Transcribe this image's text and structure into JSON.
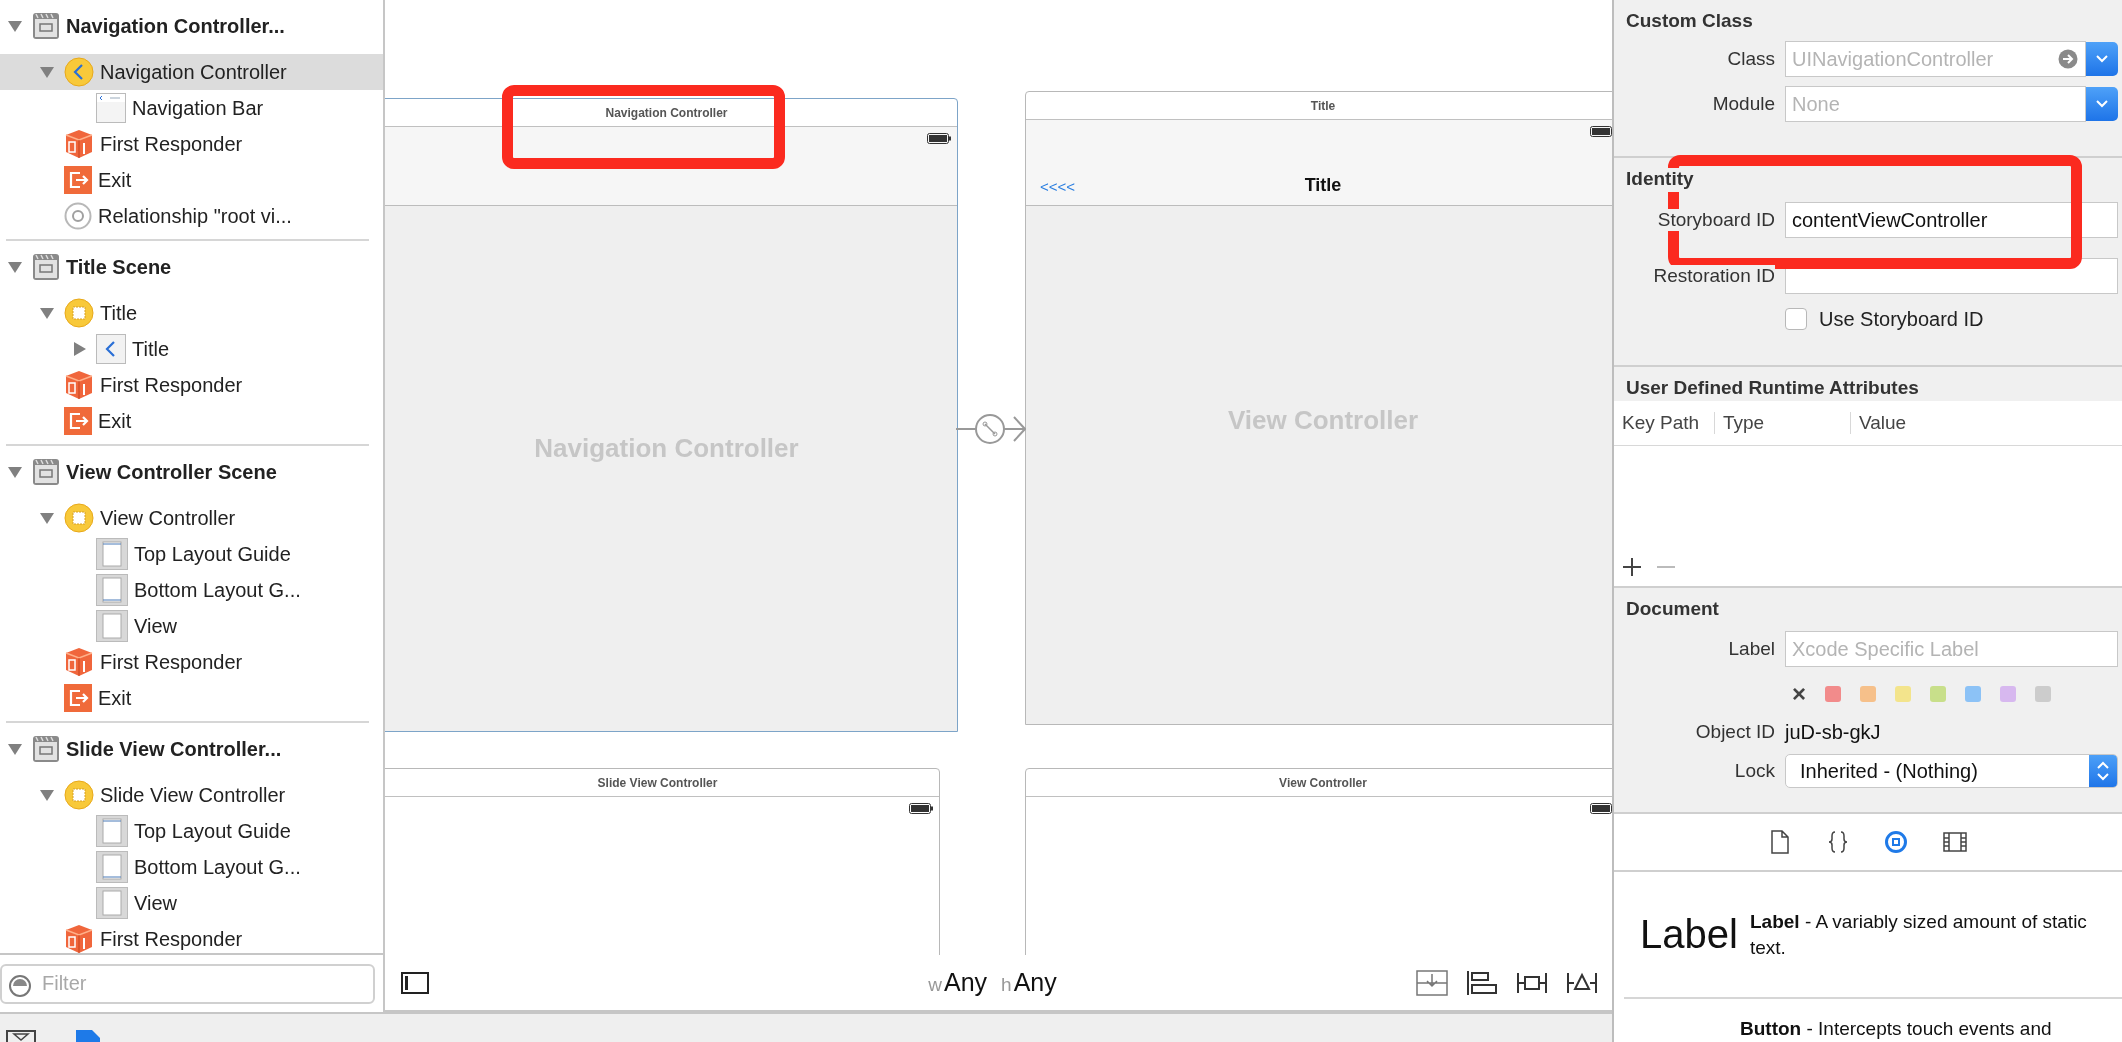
{
  "outline": {
    "scenes": [
      {
        "label": "Navigation Controller...",
        "kind": "scene",
        "expanded": true,
        "selected": false,
        "children": [
          {
            "label": "Navigation Controller",
            "kind": "nav-controller",
            "expanded": true,
            "selected": true,
            "children": [
              {
                "label": "Navigation Bar",
                "kind": "nav-bar",
                "selected": false
              }
            ]
          },
          {
            "label": "First Responder",
            "kind": "responder",
            "selected": false
          },
          {
            "label": "Exit",
            "kind": "exit",
            "selected": false
          },
          {
            "label": "Relationship \"root vi...",
            "kind": "relationship",
            "selected": false
          }
        ]
      },
      {
        "label": "Title Scene",
        "kind": "scene",
        "expanded": true,
        "selected": false,
        "children": [
          {
            "label": "Title",
            "kind": "view-controller",
            "expanded": true,
            "selected": false,
            "children": [
              {
                "label": "Title",
                "kind": "nav-item",
                "expanded": false,
                "selected": false
              }
            ]
          },
          {
            "label": "First Responder",
            "kind": "responder",
            "selected": false
          },
          {
            "label": "Exit",
            "kind": "exit",
            "selected": false
          }
        ]
      },
      {
        "label": "View Controller Scene",
        "kind": "scene",
        "expanded": true,
        "selected": false,
        "children": [
          {
            "label": "View Controller",
            "kind": "view-controller",
            "expanded": true,
            "selected": false,
            "children": [
              {
                "label": "Top Layout Guide",
                "kind": "guide-top",
                "selected": false
              },
              {
                "label": "Bottom Layout G...",
                "kind": "guide-bottom",
                "selected": false
              },
              {
                "label": "View",
                "kind": "view",
                "selected": false
              }
            ]
          },
          {
            "label": "First Responder",
            "kind": "responder",
            "selected": false
          },
          {
            "label": "Exit",
            "kind": "exit",
            "selected": false
          }
        ]
      },
      {
        "label": "Slide View Controller...",
        "kind": "scene",
        "expanded": true,
        "selected": false,
        "children": [
          {
            "label": "Slide View Controller",
            "kind": "view-controller",
            "expanded": true,
            "selected": false,
            "children": [
              {
                "label": "Top Layout Guide",
                "kind": "guide-top",
                "selected": false
              },
              {
                "label": "Bottom Layout G...",
                "kind": "guide-bottom",
                "selected": false
              },
              {
                "label": "View",
                "kind": "view",
                "selected": false
              }
            ]
          },
          {
            "label": "First Responder",
            "kind": "responder",
            "selected": false
          }
        ]
      }
    ],
    "filter": {
      "placeholder": "Filter"
    }
  },
  "canvas": {
    "scenes": [
      {
        "title": "Navigation Controller",
        "kind": "navigation",
        "body_label": "Navigation Controller"
      },
      {
        "title": "Title",
        "kind": "content",
        "back": "<<<<",
        "nav_title": "Title",
        "body_label": "View Controller"
      },
      {
        "title": "Slide View Controller",
        "kind": "blank"
      },
      {
        "title": "View Controller",
        "kind": "blank"
      }
    ],
    "size_class": {
      "w_prefix": "w",
      "w_value": "Any",
      "h_prefix": "h",
      "h_value": "Any"
    }
  },
  "inspector": {
    "custom_class": {
      "title": "Custom Class",
      "class": {
        "label": "Class",
        "placeholder": "UINavigationController"
      },
      "module": {
        "label": "Module",
        "placeholder": "None"
      }
    },
    "identity": {
      "title": "Identity",
      "storyboard_id": {
        "label": "Storyboard ID",
        "value": "contentViewController"
      },
      "restoration_id": {
        "label": "Restoration ID"
      },
      "use_storyboard_id": {
        "label": "Use Storyboard ID",
        "checked": false
      }
    },
    "runtime_attributes": {
      "title": "User Defined Runtime Attributes",
      "columns": [
        "Key Path",
        "Type",
        "Value"
      ]
    },
    "document": {
      "title": "Document",
      "label": {
        "label": "Label",
        "placeholder": "Xcode Specific Label"
      },
      "clear": "×",
      "swatches": [
        {
          "color": "#f28b8b"
        },
        {
          "color": "#f6c08a"
        },
        {
          "color": "#f3e48c"
        },
        {
          "color": "#c8df8a"
        },
        {
          "color": "#8cc2f6"
        },
        {
          "color": "#d7b8ef"
        },
        {
          "color": "#cccccc"
        }
      ],
      "object_id": {
        "label": "Object ID",
        "value": "juD-sb-gkJ"
      },
      "lock": {
        "label": "Lock",
        "value": "Inherited - (Nothing)"
      }
    },
    "library_tabs": [
      {
        "kind": "file",
        "selected": false
      },
      {
        "kind": "code",
        "selected": false
      },
      {
        "kind": "object",
        "selected": true
      },
      {
        "kind": "media",
        "selected": false
      }
    ],
    "library": [
      {
        "preview": "Label",
        "text": "**Label** - A variably sized amount of static text."
      },
      {
        "text": "**Button** - Intercepts touch events and"
      }
    ]
  }
}
